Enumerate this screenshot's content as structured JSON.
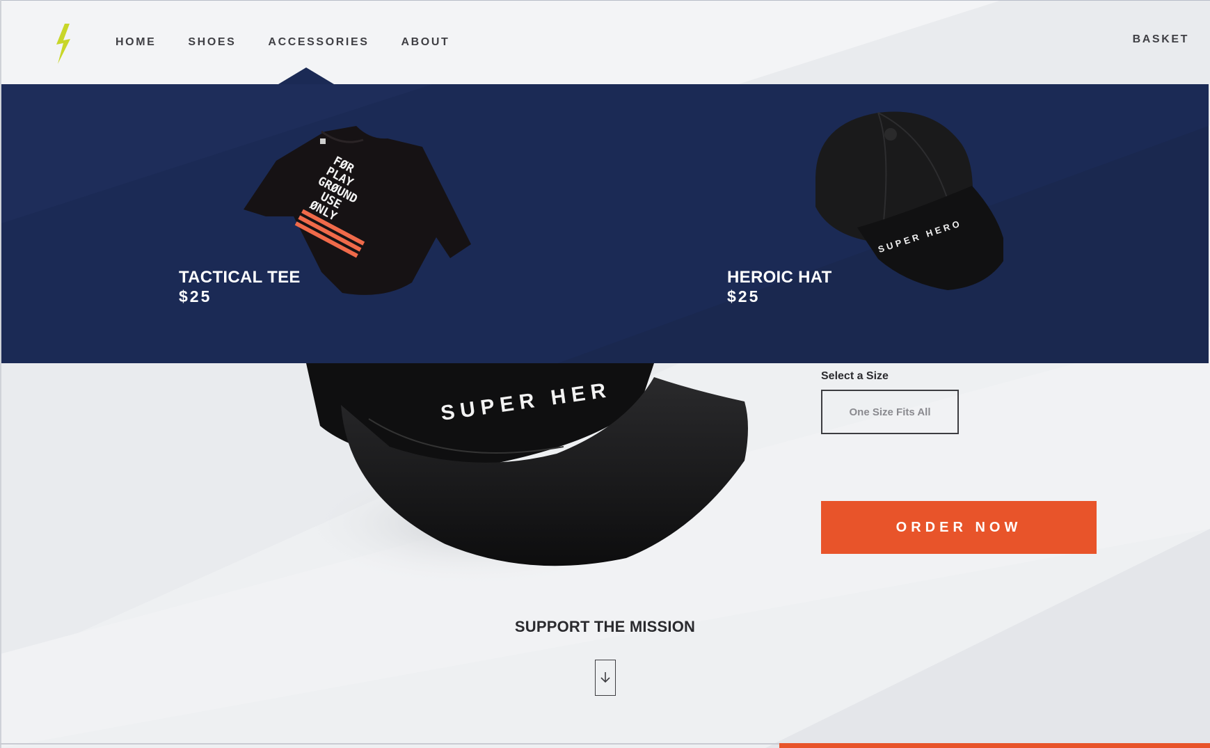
{
  "header": {
    "nav": [
      {
        "label": "HOME"
      },
      {
        "label": "SHOES"
      },
      {
        "label": "ACCESSORIES"
      },
      {
        "label": "ABOUT"
      }
    ],
    "basket_label": "BASKET",
    "logo_icon": "lightning-bolt-icon",
    "logo_color": "#c8d629"
  },
  "mega_menu": {
    "background": "#1b2a55",
    "products": [
      {
        "title": "TACTICAL TEE",
        "price": "$25",
        "image_icon": "tshirt-icon",
        "print_text": [
          "FØR",
          "PLAY",
          "GRØUND",
          "USE",
          "ØNLY"
        ]
      },
      {
        "title": "HEROIC HAT",
        "price": "$25",
        "image_icon": "cap-icon",
        "print_text": "SUPER HERO"
      }
    ]
  },
  "product": {
    "hero_text": "SUPER HER",
    "size_label": "Select a Size",
    "size_value": "One Size Fits All",
    "order_label": "ORDER NOW",
    "accent": "#e8542a"
  },
  "mission": {
    "title": "SUPPORT THE MISSION",
    "scroll_icon": "arrow-down-icon"
  }
}
